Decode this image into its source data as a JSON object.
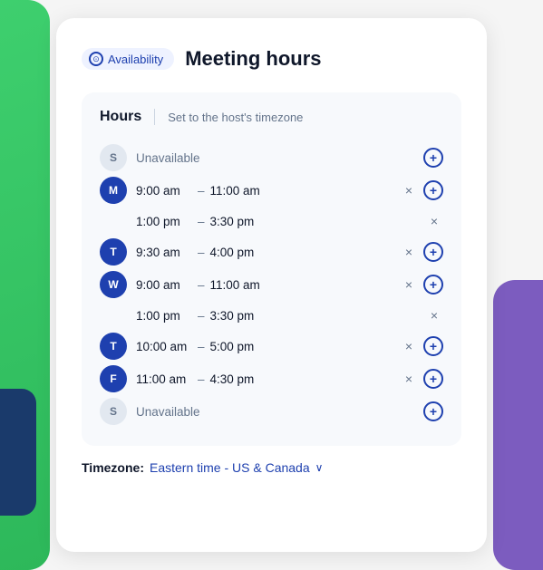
{
  "header": {
    "availability_label": "Availability",
    "page_title": "Meeting hours"
  },
  "inner": {
    "hours_label": "Hours",
    "timezone_note": "Set to the host's timezone"
  },
  "schedule": [
    {
      "id": "sunday-1",
      "day_letter": "S",
      "active": false,
      "unavailable": true,
      "unavailable_text": "Unavailable",
      "slots": []
    },
    {
      "id": "monday-1",
      "day_letter": "M",
      "active": true,
      "unavailable": false,
      "slots": [
        {
          "start": "9:00 am",
          "end": "11:00 am"
        }
      ]
    },
    {
      "id": "monday-2",
      "day_letter": null,
      "active": false,
      "unavailable": false,
      "continuation": true,
      "slots": [
        {
          "start": "1:00 pm",
          "end": "3:30 pm"
        }
      ]
    },
    {
      "id": "tuesday-1",
      "day_letter": "T",
      "active": true,
      "unavailable": false,
      "slots": [
        {
          "start": "9:30 am",
          "end": "4:00 pm"
        }
      ]
    },
    {
      "id": "wednesday-1",
      "day_letter": "W",
      "active": true,
      "unavailable": false,
      "slots": [
        {
          "start": "9:00 am",
          "end": "11:00 am"
        }
      ]
    },
    {
      "id": "wednesday-2",
      "day_letter": null,
      "active": false,
      "unavailable": false,
      "continuation": true,
      "slots": [
        {
          "start": "1:00 pm",
          "end": "3:30 pm"
        }
      ]
    },
    {
      "id": "thursday-1",
      "day_letter": "T",
      "active": true,
      "unavailable": false,
      "slots": [
        {
          "start": "10:00 am",
          "end": "5:00 pm"
        }
      ]
    },
    {
      "id": "friday-1",
      "day_letter": "F",
      "active": true,
      "unavailable": false,
      "slots": [
        {
          "start": "11:00 am",
          "end": "4:30 pm"
        }
      ]
    },
    {
      "id": "saturday-1",
      "day_letter": "S",
      "active": false,
      "unavailable": true,
      "unavailable_text": "Unavailable",
      "slots": []
    }
  ],
  "timezone": {
    "label": "Timezone:",
    "value": "Eastern time - US & Canada"
  },
  "icons": {
    "clock": "⊙",
    "plus": "+",
    "close": "×",
    "chevron": "∨"
  }
}
